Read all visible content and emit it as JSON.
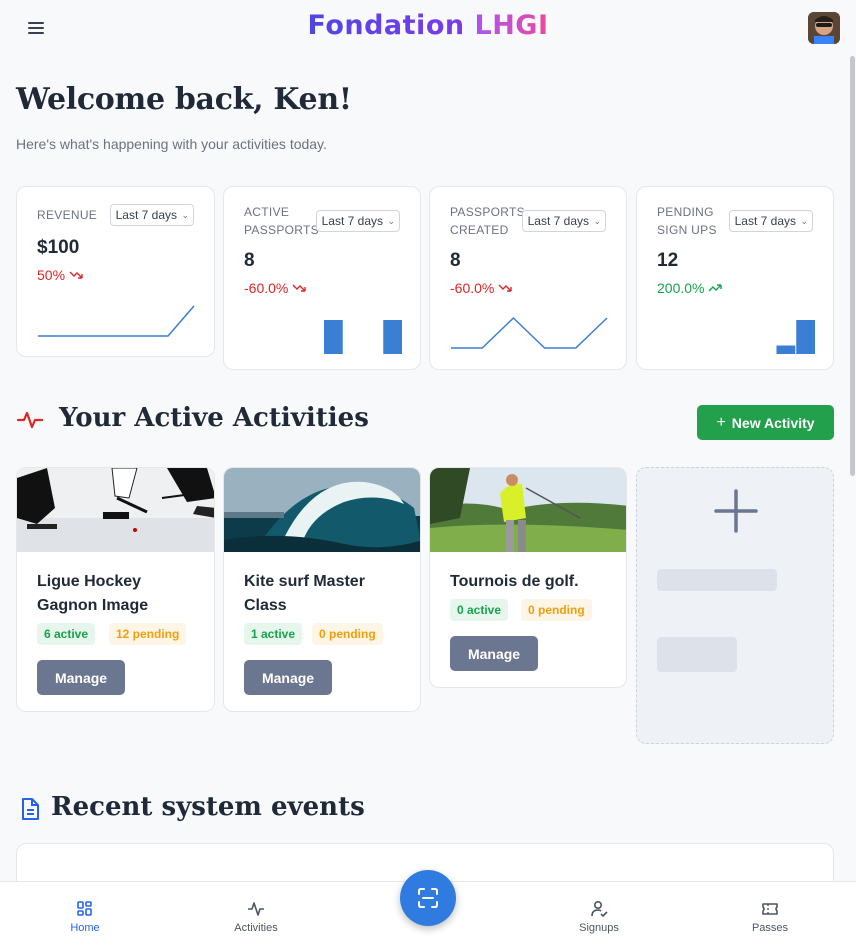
{
  "header": {
    "brand_part1": "Fondation",
    "brand_part2": "LHGI",
    "menu_icon": "hamburger-icon",
    "avatar_icon": "user-avatar"
  },
  "welcome": {
    "title": "Welcome back, Ken!",
    "subtitle": "Here's what's happening with your activities today."
  },
  "stats": [
    {
      "label_line1": "REVENUE",
      "label_line2": "",
      "period": "Last 7 days",
      "value": "$100",
      "change": "50%",
      "trend": "down",
      "spark_type": "line",
      "spark": [
        0,
        0,
        0,
        0,
        0,
        0,
        1
      ]
    },
    {
      "label_line1": "ACTIVE",
      "label_line2": "PASSPORTS",
      "period": "Last 7 days",
      "value": "8",
      "change": "-60.0%",
      "trend": "down",
      "spark_type": "bar",
      "spark": [
        0,
        0,
        0,
        0,
        1,
        0,
        0,
        1
      ]
    },
    {
      "label_line1": "PASSPORTS",
      "label_line2": "CREATED",
      "period": "Last 7 days",
      "value": "8",
      "change": "-60.0%",
      "trend": "down",
      "spark_type": "line",
      "spark": [
        0,
        0,
        1,
        0,
        0,
        1
      ]
    },
    {
      "label_line1": "PENDING",
      "label_line2": "SIGN UPS",
      "period": "Last 7 days",
      "value": "12",
      "change": "200.0%",
      "trend": "up",
      "spark_type": "bar",
      "spark": [
        0,
        0,
        0,
        0,
        0,
        0,
        0.25,
        1
      ]
    }
  ],
  "activities_section": {
    "title": "Your Active Activities",
    "title_icon": "activity-pulse-icon",
    "new_button": "New Activity"
  },
  "activities": [
    {
      "name": "Ligue Hockey Gagnon Image",
      "active": "6 active",
      "pending": "12 pending",
      "manage": "Manage",
      "image": "hockey"
    },
    {
      "name": "Kite surf Master Class",
      "active": "1 active",
      "pending": "0 pending",
      "manage": "Manage",
      "image": "wave"
    },
    {
      "name": "Tournois de golf.",
      "active": "0 active",
      "pending": "0 pending",
      "manage": "Manage",
      "image": "golf"
    }
  ],
  "events_section": {
    "title": "Recent system events",
    "title_icon": "document-icon"
  },
  "bottom_nav": {
    "items": [
      {
        "label": "Home",
        "icon": "home-grid-icon",
        "active": true
      },
      {
        "label": "Activities",
        "icon": "activity-pulse-icon",
        "active": false
      },
      {
        "label": "Signups",
        "icon": "user-check-icon",
        "active": false
      },
      {
        "label": "Passes",
        "icon": "ticket-icon",
        "active": false
      }
    ],
    "scan_icon": "scan-icon"
  },
  "colors": {
    "accent_blue": "#2f7be0",
    "success_green": "#22a04b",
    "negative_red": "#dc2626",
    "positive_green": "#16a34a",
    "manage_gray": "#6b7690"
  }
}
